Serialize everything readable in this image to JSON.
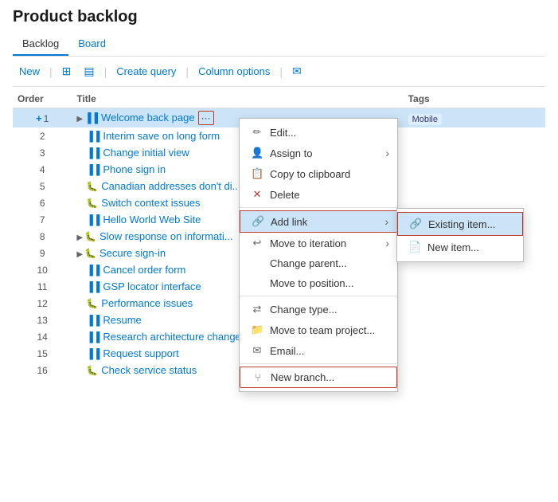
{
  "page": {
    "title": "Product backlog"
  },
  "tabs": [
    {
      "label": "Backlog",
      "active": true
    },
    {
      "label": "Board",
      "active": false
    }
  ],
  "toolbar": {
    "new_label": "New",
    "create_query_label": "Create query",
    "column_options_label": "Column options"
  },
  "columns": [
    {
      "key": "order",
      "label": "Order"
    },
    {
      "key": "title",
      "label": "Title"
    },
    {
      "key": "tags",
      "label": "Tags"
    }
  ],
  "rows": [
    {
      "id": 1,
      "order": 1,
      "type": "story",
      "title": "Welcome back page",
      "tags": "Mobile",
      "highlighted": true,
      "expand": true,
      "ellipsis": true
    },
    {
      "id": 2,
      "order": 2,
      "type": "story",
      "title": "Interim save on long form",
      "tags": "",
      "highlighted": false
    },
    {
      "id": 3,
      "order": 3,
      "type": "story",
      "title": "Change initial view",
      "tags": "",
      "highlighted": false
    },
    {
      "id": 4,
      "order": 4,
      "type": "story",
      "title": "Phone sign in",
      "tags": "",
      "highlighted": false
    },
    {
      "id": 5,
      "order": 5,
      "type": "bug",
      "title": "Canadian addresses don't di...",
      "tags": "",
      "highlighted": false
    },
    {
      "id": 6,
      "order": 6,
      "type": "bug",
      "title": "Switch context issues",
      "tags": "",
      "highlighted": false
    },
    {
      "id": 7,
      "order": 7,
      "type": "story",
      "title": "Hello World Web Site",
      "tags": "",
      "highlighted": false
    },
    {
      "id": 8,
      "order": 8,
      "type": "bug",
      "title": "Slow response on informati...",
      "tags": "",
      "highlighted": false,
      "expand": true
    },
    {
      "id": 9,
      "order": 9,
      "type": "bug",
      "title": "Secure sign-in",
      "tags": "",
      "highlighted": false,
      "expand": true
    },
    {
      "id": 10,
      "order": 10,
      "type": "story",
      "title": "Cancel order form",
      "tags": "",
      "highlighted": false
    },
    {
      "id": 11,
      "order": 11,
      "type": "story",
      "title": "GSP locator interface",
      "tags": "",
      "highlighted": false
    },
    {
      "id": 12,
      "order": 12,
      "type": "bug",
      "title": "Performance issues",
      "tags": "",
      "highlighted": false
    },
    {
      "id": 13,
      "order": 13,
      "type": "story",
      "title": "Resume",
      "tags": "",
      "highlighted": false
    },
    {
      "id": 14,
      "order": 14,
      "type": "story",
      "title": "Research architecture changes",
      "tags": "",
      "highlighted": false
    },
    {
      "id": 15,
      "order": 15,
      "type": "story",
      "title": "Request support",
      "tags": "",
      "highlighted": false
    },
    {
      "id": 16,
      "order": 16,
      "type": "bug",
      "title": "Check service status",
      "tags": "",
      "highlighted": false
    }
  ],
  "context_menu": {
    "items": [
      {
        "label": "Edit...",
        "icon": "✏️",
        "id": "edit"
      },
      {
        "label": "Assign to",
        "icon": "👤",
        "id": "assign",
        "submenu": true
      },
      {
        "label": "Copy to clipboard",
        "icon": "📋",
        "id": "copy"
      },
      {
        "label": "Delete",
        "icon": "✕",
        "id": "delete",
        "red": true
      },
      {
        "separator": true
      },
      {
        "label": "Add link",
        "icon": "🔗",
        "id": "addlink",
        "submenu": true,
        "highlighted": true
      },
      {
        "label": "Move to iteration",
        "icon": "↩",
        "id": "move_iter",
        "submenu": true
      },
      {
        "label": "Change parent...",
        "icon": "",
        "id": "change_parent"
      },
      {
        "label": "Move to position...",
        "icon": "",
        "id": "move_pos"
      },
      {
        "separator": true
      },
      {
        "label": "Change type...",
        "icon": "↔",
        "id": "change_type"
      },
      {
        "label": "Move to team project...",
        "icon": "📁",
        "id": "move_proj"
      },
      {
        "label": "Email...",
        "icon": "✉",
        "id": "email"
      },
      {
        "separator": true
      },
      {
        "label": "New branch...",
        "icon": "⑂",
        "id": "new_branch"
      }
    ],
    "submenu_addlink": [
      {
        "label": "Existing item...",
        "icon": "🔗",
        "id": "existing_item",
        "highlighted": true
      },
      {
        "label": "New item...",
        "icon": "📄",
        "id": "new_item"
      }
    ]
  }
}
